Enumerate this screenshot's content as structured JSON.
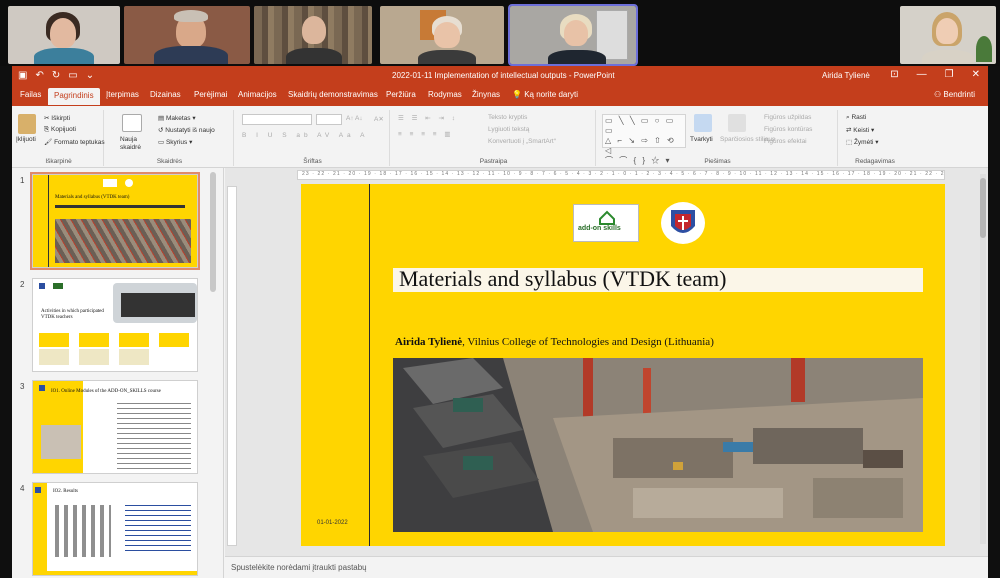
{
  "window": {
    "title": "2022-01-11 Implementation of intellectual outputs - PowerPoint",
    "user": "Airida Tylienė",
    "controls": {
      "minimize": "—",
      "restore": "❐",
      "close": "✕"
    }
  },
  "tabs": [
    "Failas",
    "Pagrindinis",
    "Įterpimas",
    "Dizainas",
    "Perėjimai",
    "Animacijos",
    "Skaidrių demonstravimas",
    "Peržiūra",
    "Rodymas",
    "Žinynas"
  ],
  "tell_me": "Ką norite daryti",
  "share": "Bendrinti",
  "ribbon": {
    "clipboard": {
      "paste": "Įklijuoti",
      "cut": "Iškirpti",
      "copy": "Kopijuoti",
      "format": "Formato teptukas",
      "label": "Iškarpinė"
    },
    "slides": {
      "new_slide": "Nauja skaidrė",
      "layout": "Maketas",
      "reset": "Nustatyti iš naujo",
      "section": "Skyrius",
      "label": "Skaidrės"
    },
    "font": {
      "label": "Šriftas"
    },
    "paragraph": {
      "text_direction": "Teksto kryptis",
      "align_text": "Lygiuoti tekstą",
      "smartart": "Konvertuoti į „SmartArt“",
      "label": "Pastraipa"
    },
    "drawing": {
      "arrange": "Tvarkyti",
      "quick_styles": "Sparčiosios stiliaus",
      "fill": "Figūros užpildas",
      "outline": "Figūros kontūras",
      "effects": "Figūros efektai",
      "label": "Piešimas"
    },
    "editing": {
      "find": "Rasti",
      "replace": "Keisti",
      "select": "Žymėti",
      "label": "Redagavimas"
    }
  },
  "thumbnails": [
    {
      "num": "1",
      "title": "Materials and syllabus (VTDK team)"
    },
    {
      "num": "2",
      "title": "Activities in which participated VTDK teachers"
    },
    {
      "num": "3",
      "title": "IO1. Online Modules of the ADD-ON_SKILLS course"
    },
    {
      "num": "4",
      "title": "IO2. Results"
    }
  ],
  "slide": {
    "logo_text": "add-on skills",
    "title": "Materials and syllabus (VTDK team)",
    "author_bold": "Airida Tylienė",
    "author_rest": ", Vilnius College of Technologies and Design (Lithuania)",
    "date": "01-01-2022"
  },
  "ruler_text": "23 · 22 · 21 · 20 · 19 · 18 · 17 · 16 · 15 · 14 · 13 · 12 · 11 · 10 · 9 · 8 · 7 · 6 · 5 · 4 · 3 · 2 · 1 · 0 · 1 · 2 · 3 · 4 · 5 · 6 · 7 · 8 · 9 · 10 · 11 · 12 · 13 · 14 · 15 · 16 · 17 · 18 · 19 · 20 · 21 · 22 · 23 · 24 · 25",
  "notes_placeholder": "Spustelėkite norėdami įtraukti pastabų",
  "colors": {
    "accent": "#c43e1c",
    "slide_bg": "#ffd500"
  }
}
